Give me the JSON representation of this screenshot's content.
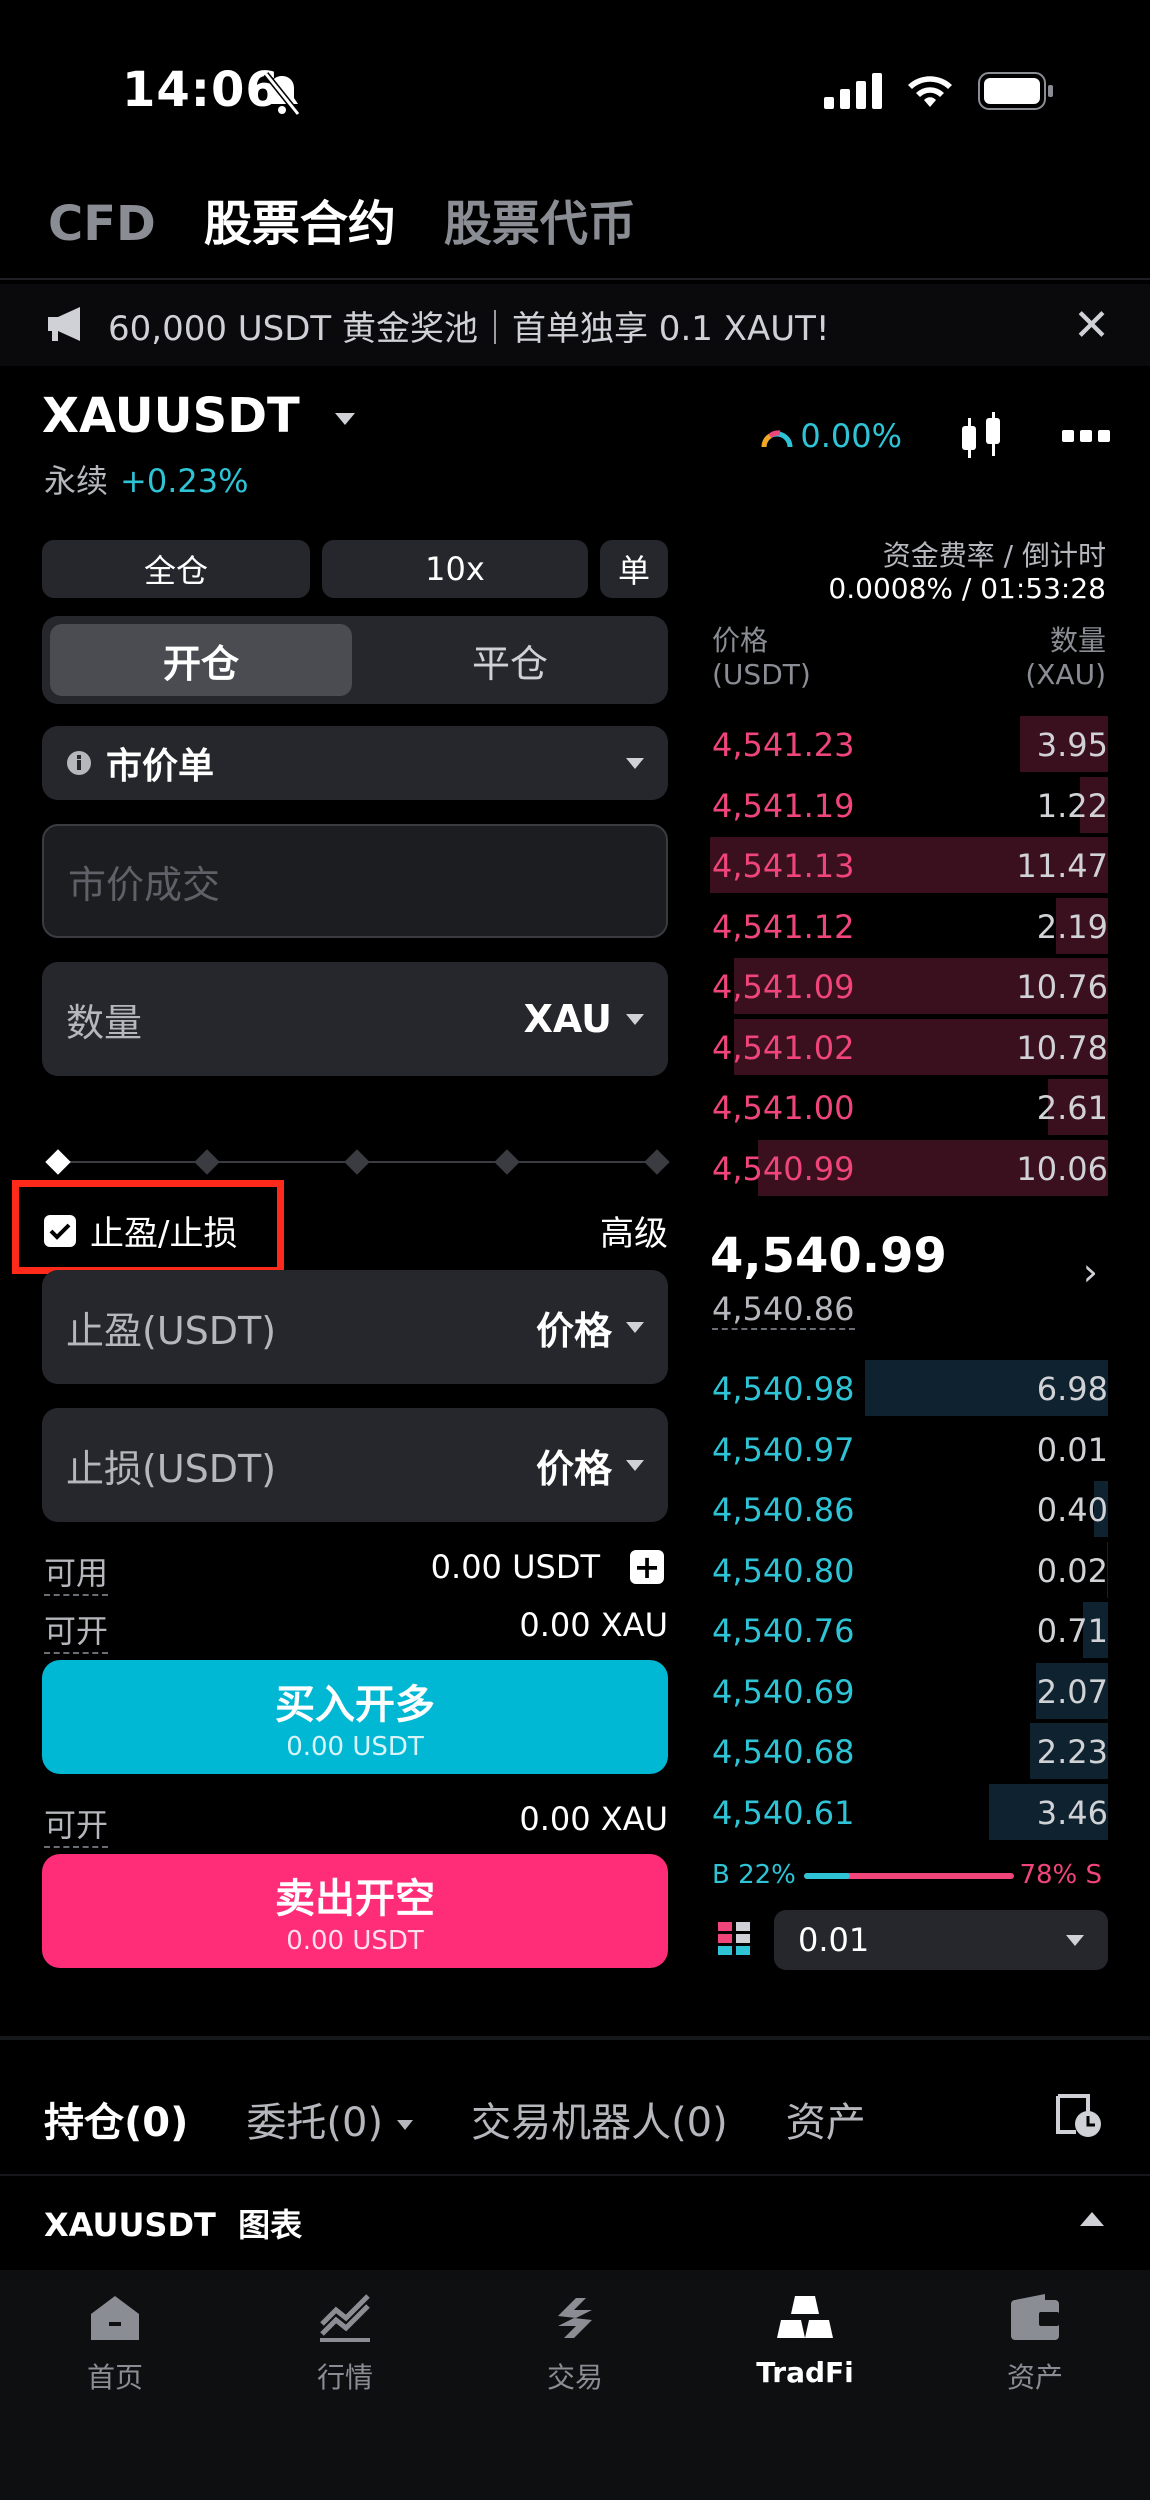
{
  "status_bar": {
    "time": "14:06"
  },
  "top_tabs": [
    "CFD",
    "股票合约",
    "股票代币"
  ],
  "announcement": "60,000 USDT 黄金奖池｜首单独享 0.1 XAUT!",
  "symbol": {
    "name": "XAUUSDT",
    "type": "永续",
    "change": "+0.23%",
    "gauge_value": "0.00%"
  },
  "controls": {
    "margin_mode": "全仓",
    "leverage": "10x",
    "position_mode": "单"
  },
  "funding": {
    "label": "资金费率 / 倒计时",
    "value": "0.0008% / 01:53:28"
  },
  "open_close": {
    "open": "开仓",
    "close": "平仓"
  },
  "order_type": "市价单",
  "price_placeholder": "市价成交",
  "quantity": {
    "label": "数量",
    "unit": "XAU"
  },
  "tpsl": {
    "label": "止盈/止损",
    "advanced": "高级",
    "checked": true
  },
  "take_profit": {
    "label": "止盈(USDT)",
    "mode": "价格"
  },
  "stop_loss": {
    "label": "止损(USDT)",
    "mode": "价格"
  },
  "available": {
    "label": "可用",
    "value": "0.00 USDT"
  },
  "can_open_long": {
    "label": "可开",
    "value": "0.00 XAU"
  },
  "buy": {
    "label": "买入开多",
    "sub": "0.00 USDT"
  },
  "can_open_short": {
    "label": "可开",
    "value": "0.00 XAU"
  },
  "sell": {
    "label": "卖出开空",
    "sub": "0.00 USDT"
  },
  "orderbook": {
    "price_header": "价格",
    "price_unit": "(USDT)",
    "qty_header": "数量",
    "qty_unit": "(XAU)",
    "asks": [
      {
        "price": "4,541.23",
        "qty": "3.95",
        "depth": 0.22
      },
      {
        "price": "4,541.19",
        "qty": "1.22",
        "depth": 0.07
      },
      {
        "price": "4,541.13",
        "qty": "11.47",
        "depth": 1.0
      },
      {
        "price": "4,541.12",
        "qty": "2.19",
        "depth": 0.13
      },
      {
        "price": "4,541.09",
        "qty": "10.76",
        "depth": 0.94
      },
      {
        "price": "4,541.02",
        "qty": "10.78",
        "depth": 0.94
      },
      {
        "price": "4,541.00",
        "qty": "2.61",
        "depth": 0.15
      },
      {
        "price": "4,540.99",
        "qty": "10.06",
        "depth": 0.88
      }
    ],
    "last_price": "4,540.99",
    "mark_price": "4,540.86",
    "bids": [
      {
        "price": "4,540.98",
        "qty": "6.98",
        "depth": 0.61
      },
      {
        "price": "4,540.97",
        "qty": "0.01",
        "depth": 0.0
      },
      {
        "price": "4,540.86",
        "qty": "0.40",
        "depth": 0.035
      },
      {
        "price": "4,540.80",
        "qty": "0.02",
        "depth": 0.002
      },
      {
        "price": "4,540.76",
        "qty": "0.71",
        "depth": 0.062
      },
      {
        "price": "4,540.69",
        "qty": "2.07",
        "depth": 0.18
      },
      {
        "price": "4,540.68",
        "qty": "2.23",
        "depth": 0.195
      },
      {
        "price": "4,540.61",
        "qty": "3.46",
        "depth": 0.3
      }
    ],
    "buy_ratio": "B 22%",
    "sell_ratio": "78% S",
    "buy_ratio_value": 0.22,
    "precision": "0.01"
  },
  "bottom_tabs": [
    "持仓(0)",
    "委托(0)",
    "交易机器人(0)",
    "资产"
  ],
  "chart_row": "XAUUSDT  图表",
  "nav": [
    "首页",
    "行情",
    "交易",
    "TradFi",
    "资产"
  ],
  "colors": {
    "buy": "#00b8d4",
    "sell": "#ff2d78",
    "highlight": "#ff2a1a"
  }
}
